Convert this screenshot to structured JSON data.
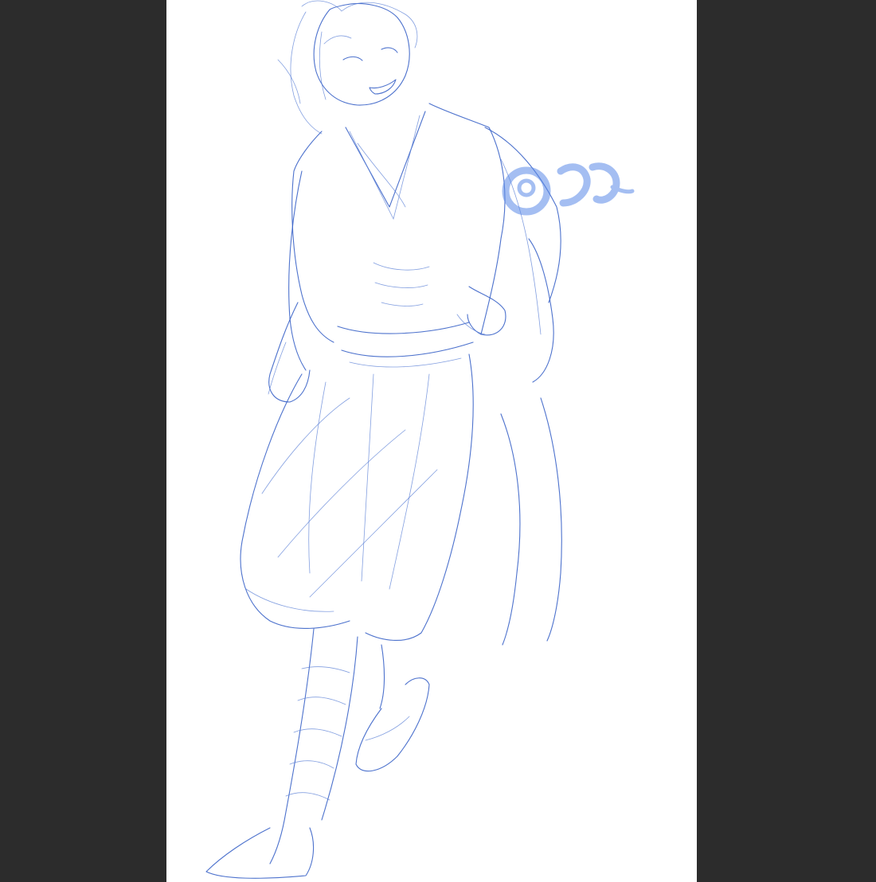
{
  "app": {
    "background_color": "#2c2c2c",
    "canvas_color": "#ffffff",
    "stroke_color": "#3a63c8",
    "tool": "sketch-brush"
  },
  "canvas": {
    "content": "line-sketch-figure",
    "signature_text": "@シン"
  }
}
